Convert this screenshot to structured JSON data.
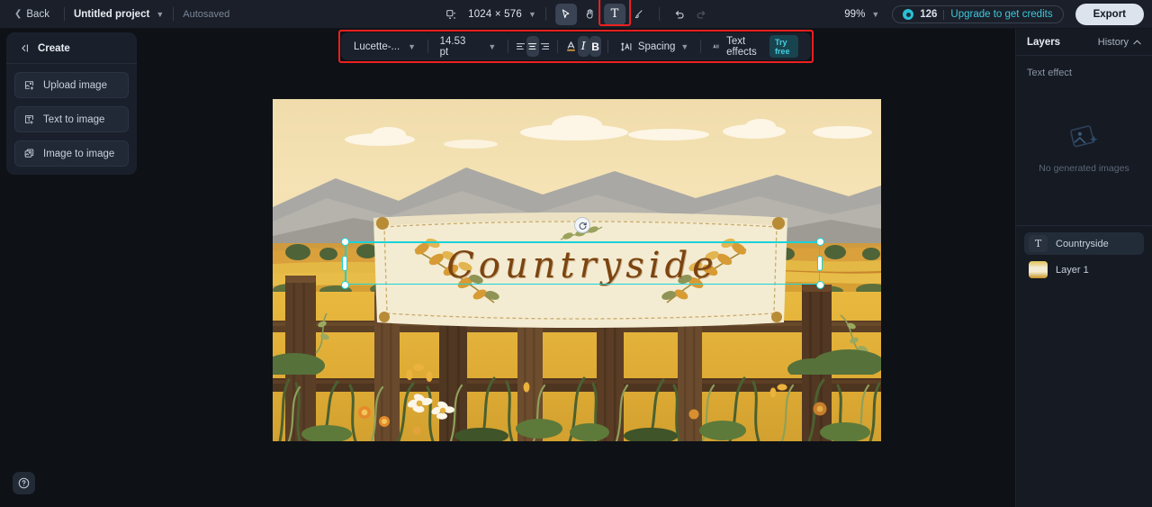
{
  "header": {
    "back_label": "Back",
    "project_name": "Untitled project",
    "autosaved_label": "Autosaved",
    "canvas_size": "1024 × 576",
    "zoom_level": "99%",
    "credits_count": "126",
    "upgrade_label": "Upgrade to get credits",
    "export_label": "Export",
    "tools": [
      {
        "name": "frame-icon",
        "label": "Frame"
      },
      {
        "name": "select-icon",
        "label": "Select"
      },
      {
        "name": "hand-icon",
        "label": "Hand"
      },
      {
        "name": "text-tool-icon",
        "label": "T"
      },
      {
        "name": "brush-icon",
        "label": "Brush"
      },
      {
        "name": "undo-icon",
        "label": "Undo"
      },
      {
        "name": "redo-icon",
        "label": "Redo"
      }
    ]
  },
  "format_toolbar": {
    "font_family": "Lucette-...",
    "font_size": "14.53 pt",
    "align_left": "Align left",
    "align_center": "Align center",
    "align_right": "Align right",
    "text_color": "Text color",
    "italic": "Italic",
    "bold": "Bold",
    "spacing_label": "Spacing",
    "text_effects_label": "Text effects",
    "try_free_badge": "Try free",
    "accent_color": "#ef2020",
    "text_color_swatch": "#d39a3a"
  },
  "left_panel": {
    "create_label": "Create",
    "items": [
      {
        "label": "Upload image",
        "icon": "upload-image-icon"
      },
      {
        "label": "Text to image",
        "icon": "text-to-image-icon"
      },
      {
        "label": "Image to image",
        "icon": "image-to-image-icon"
      }
    ],
    "help_label": "Help"
  },
  "right_panel": {
    "title": "Layers",
    "history_label": "History",
    "text_effect_label": "Text effect",
    "empty_state": "No generated images",
    "layers": [
      {
        "name": "Countryside",
        "type": "text",
        "selected": true
      },
      {
        "name": "Layer 1",
        "type": "image",
        "selected": false
      }
    ]
  },
  "canvas": {
    "text_content": "Countryside",
    "selection_color": "#19d3d8",
    "rotate_handle": "rotate-icon"
  }
}
